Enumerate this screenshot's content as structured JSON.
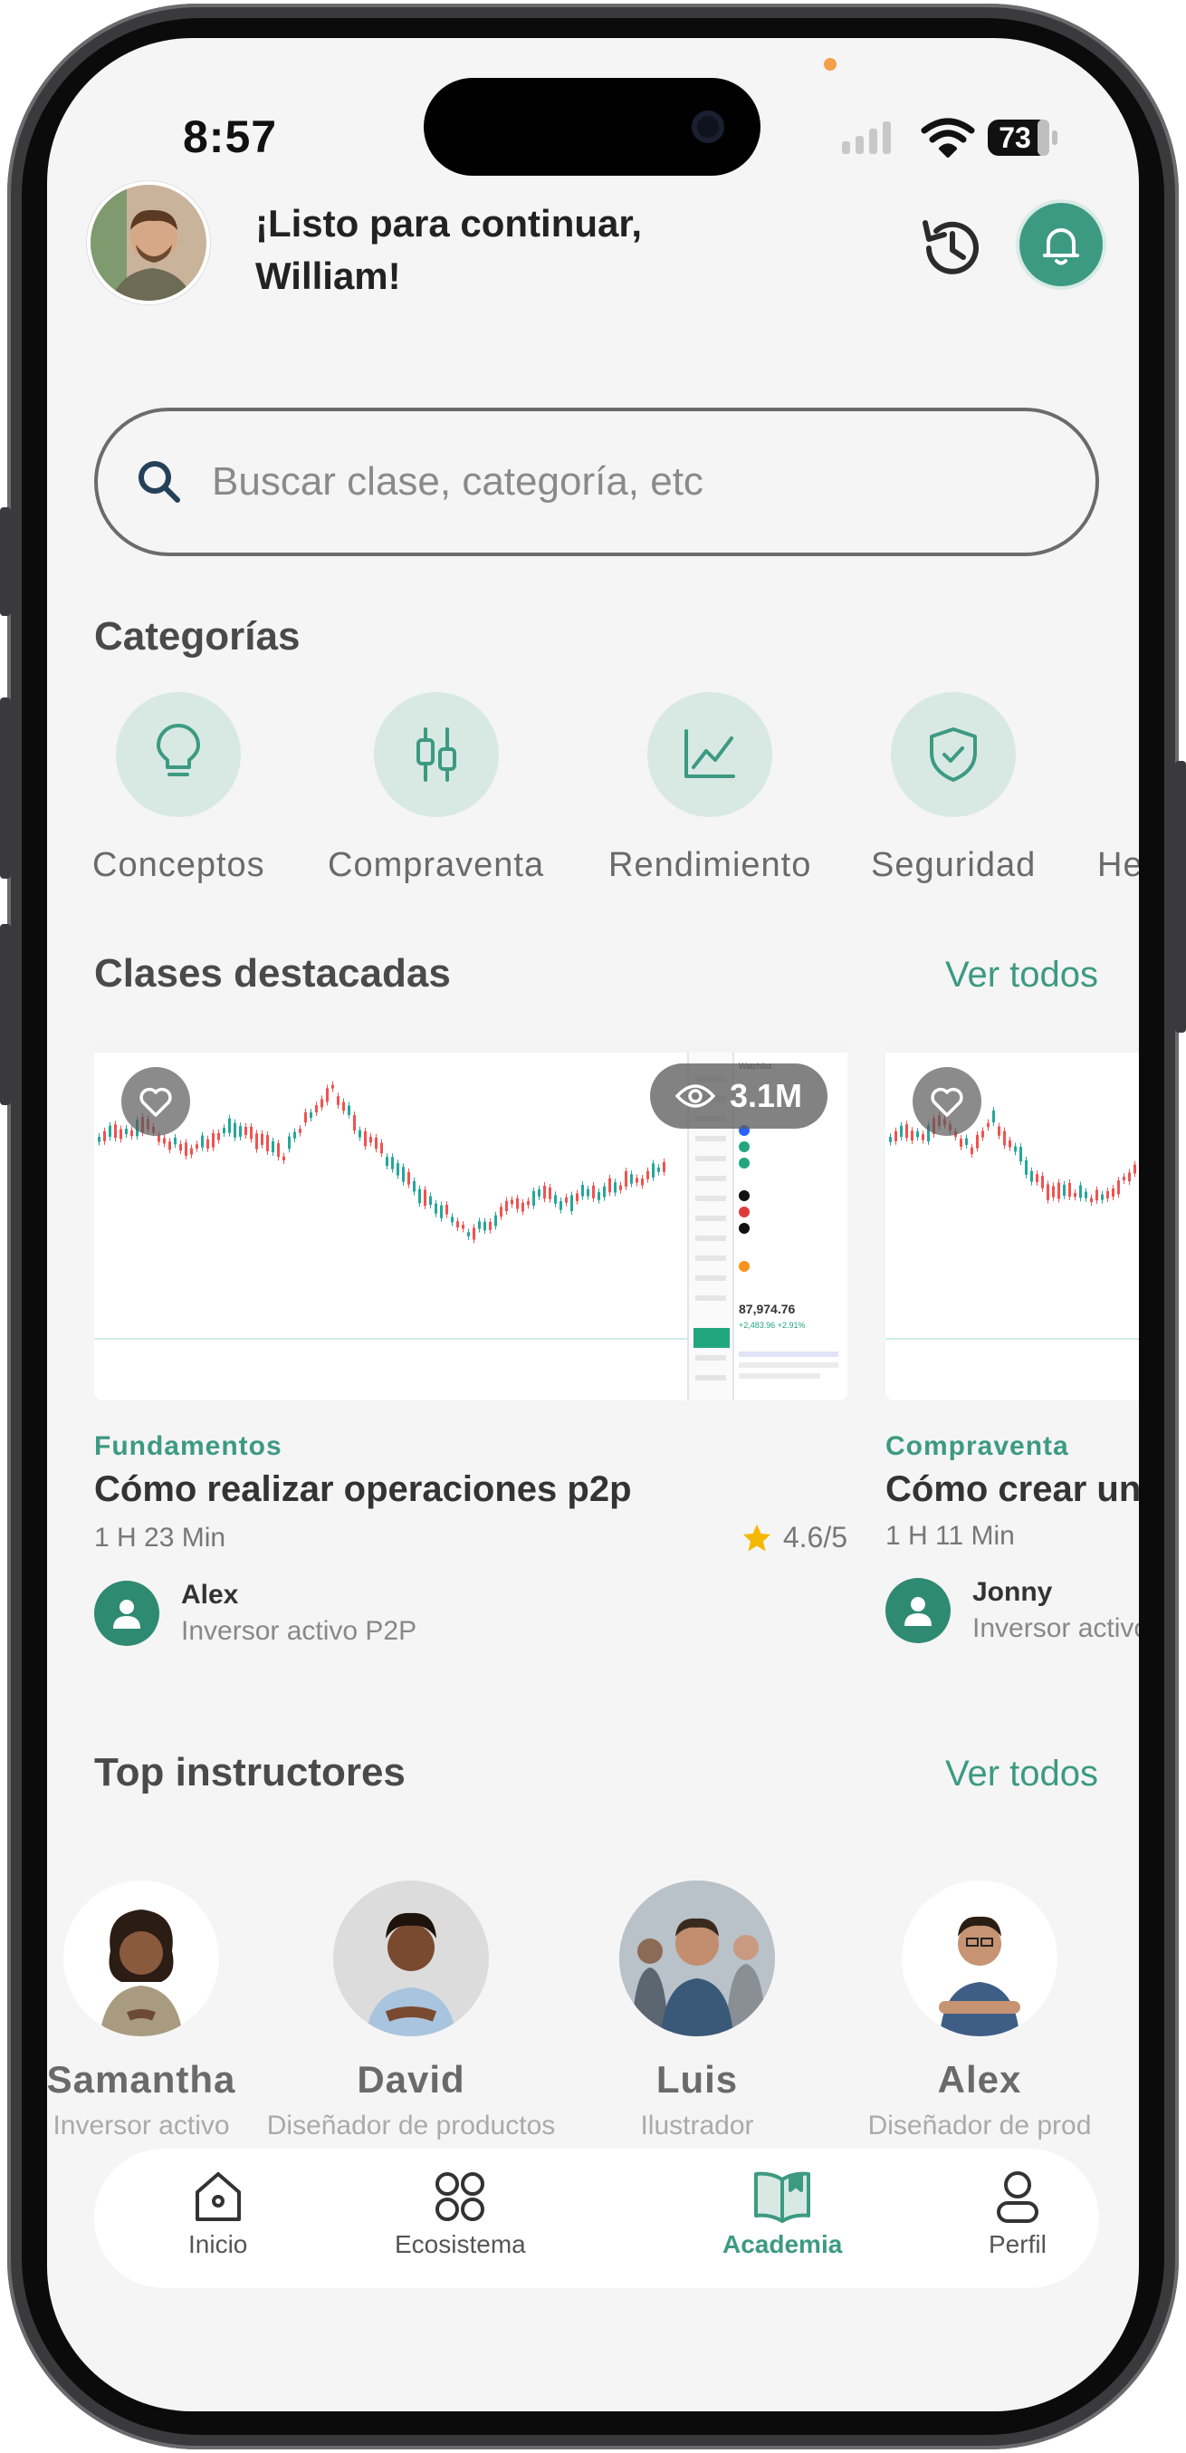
{
  "status_bar": {
    "time": "8:57",
    "battery": "73"
  },
  "header": {
    "greeting_line1": "¡Listo para continuar,",
    "greeting_line2": "William!",
    "history_icon": "history-icon",
    "bell_icon": "bell-icon"
  },
  "search": {
    "placeholder": "Buscar clase, categoría, etc",
    "value": ""
  },
  "categories": {
    "title": "Categorías",
    "items": [
      {
        "label": "Conceptos",
        "icon": "lightbulb-icon"
      },
      {
        "label": "Compraventa",
        "icon": "sliders-icon"
      },
      {
        "label": "Rendimiento",
        "icon": "chart-line-icon"
      },
      {
        "label": "Seguridad",
        "icon": "shield-check-icon"
      },
      {
        "label": "He",
        "icon": ""
      }
    ]
  },
  "featured": {
    "title": "Clases destacadas",
    "see_all": "Ver todos",
    "cards": [
      {
        "views": "3.1M",
        "category": "Fundamentos",
        "title": "Cómo realizar operaciones p2p",
        "duration": "1 H 23 Min",
        "rating": "4.6/5",
        "author_name": "Alex",
        "author_role": "Inversor activo P2P"
      },
      {
        "views": "",
        "category": "Compraventa",
        "title": "Cómo crear un",
        "duration": "1 H 11 Min",
        "rating": "",
        "author_name": "Jonny",
        "author_role": "Inversor activo"
      }
    ]
  },
  "instructors": {
    "title": "Top instructores",
    "see_all": "Ver todos",
    "items": [
      {
        "name": "Samantha",
        "role": "Inversor activo"
      },
      {
        "name": "David",
        "role": "Diseñador de productos"
      },
      {
        "name": "Luis",
        "role": "Ilustrador"
      },
      {
        "name": "Alex",
        "role": "Diseñador de prod"
      }
    ]
  },
  "nav": {
    "items": [
      {
        "label": "Inicio",
        "icon": "home-icon"
      },
      {
        "label": "Ecosistema",
        "icon": "grid-icon"
      },
      {
        "label": "Academia",
        "icon": "book-icon",
        "active": true
      },
      {
        "label": "Perfil",
        "icon": "user-icon"
      }
    ]
  },
  "colors": {
    "accent": "#3d9a82",
    "accent_light": "#d8e9e3",
    "background": "#f5f5f5"
  }
}
